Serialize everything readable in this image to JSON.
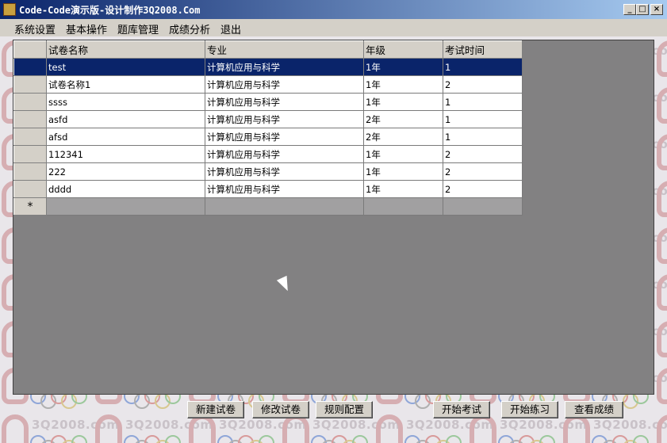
{
  "window": {
    "title": "Code-Code演示版-设计制作3Q2008.Com",
    "minimize": "_",
    "maximize": "□",
    "close": "×"
  },
  "watermark": {
    "text": "3Q2008.com"
  },
  "menu": [
    "系统设置",
    "基本操作",
    "题库管理",
    "成绩分析",
    "退出"
  ],
  "grid": {
    "columns": [
      "试卷名称",
      "专业",
      "年级",
      "考试时间"
    ],
    "rows": [
      [
        "test",
        "计算机应用与科学",
        "1年",
        "1"
      ],
      [
        "试卷名称1",
        "计算机应用与科学",
        "1年",
        "2"
      ],
      [
        "ssss",
        "计算机应用与科学",
        "1年",
        "1"
      ],
      [
        "asfd",
        "计算机应用与科学",
        "2年",
        "1"
      ],
      [
        "afsd",
        "计算机应用与科学",
        "2年",
        "1"
      ],
      [
        "112341",
        "计算机应用与科学",
        "1年",
        "2"
      ],
      [
        "222",
        "计算机应用与科学",
        "1年",
        "2"
      ],
      [
        "dddd",
        "计算机应用与科学",
        "1年",
        "2"
      ]
    ],
    "selected_row": 0,
    "new_row_marker": "*"
  },
  "buttons": {
    "new_paper": "新建试卷",
    "edit_paper": "修改试卷",
    "rule_config": "规则配置",
    "start_exam": "开始考试",
    "start_practice": "开始练习",
    "view_scores": "查看成绩"
  },
  "colors": {
    "titlebar_start": "#0a246a",
    "titlebar_end": "#a6caf0",
    "selection": "#0a246a",
    "chrome": "#d4d0c8"
  }
}
